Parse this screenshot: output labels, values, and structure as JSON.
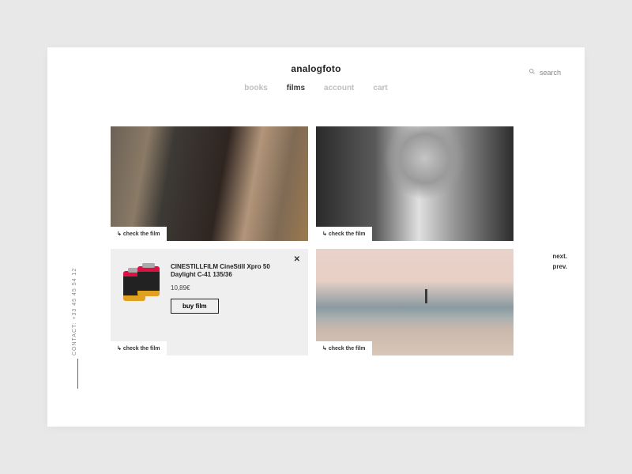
{
  "brand": "analogfoto",
  "nav": {
    "items": [
      "books",
      "films",
      "account",
      "cart"
    ],
    "active_index": 1
  },
  "search": {
    "label": "search"
  },
  "contact": {
    "text": "CONTACT: +33 45 45 54 12"
  },
  "pager": {
    "next": "next.",
    "prev": "prev."
  },
  "cards": {
    "check_label": "check the film"
  },
  "product": {
    "name": "CINESTILLFILM CineStill Xpro 50 Daylight C-41 135/36",
    "price": "10,89€",
    "buy_label": "buy film"
  }
}
